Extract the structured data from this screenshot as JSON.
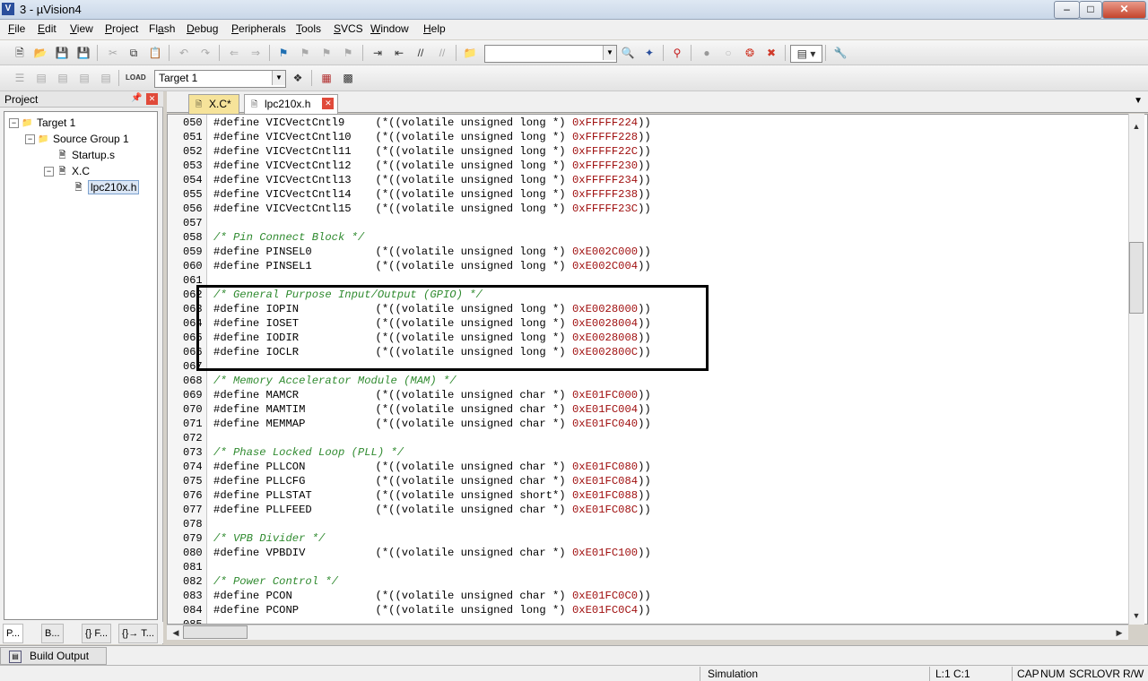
{
  "window": {
    "title": "3 - µVision4",
    "app_icon": "V"
  },
  "menu": [
    "File",
    "Edit",
    "View",
    "Project",
    "Flash",
    "Debug",
    "Peripherals",
    "Tools",
    "SVCS",
    "Window",
    "Help"
  ],
  "menu_underline": [
    "F",
    "E",
    "V",
    "P",
    "a",
    "D",
    "P",
    "T",
    "S",
    "W",
    "H"
  ],
  "toolbar2": {
    "target_label": "Target 1"
  },
  "project": {
    "header": "Project",
    "tree": [
      {
        "label": "Target 1",
        "level": 0,
        "expand": "−",
        "icon": "folder-icon"
      },
      {
        "label": "Source Group 1",
        "level": 1,
        "expand": "−",
        "icon": "folder-icon"
      },
      {
        "label": "Startup.s",
        "level": 2,
        "expand": "",
        "icon": "file-icon"
      },
      {
        "label": "X.C",
        "level": 2,
        "expand": "−",
        "icon": "file-icon"
      },
      {
        "label": "lpc210x.h",
        "level": 3,
        "expand": "",
        "icon": "header-file-icon"
      }
    ],
    "bottom_tabs": [
      "P...",
      "B...",
      "{} F...",
      "{}→ T..."
    ]
  },
  "editor": {
    "tabs": [
      {
        "label": "X.C*",
        "active": false
      },
      {
        "label": "lpc210x.h",
        "active": true
      }
    ],
    "lines": [
      {
        "n": "050",
        "kind": "def",
        "name": "VICVectCntl9",
        "cast": "(*((volatile unsigned long *) ",
        "addr": "0xFFFFF224",
        "tail": "))"
      },
      {
        "n": "051",
        "kind": "def",
        "name": "VICVectCntl10",
        "cast": "(*((volatile unsigned long *) ",
        "addr": "0xFFFFF228",
        "tail": "))"
      },
      {
        "n": "052",
        "kind": "def",
        "name": "VICVectCntl11",
        "cast": "(*((volatile unsigned long *) ",
        "addr": "0xFFFFF22C",
        "tail": "))"
      },
      {
        "n": "053",
        "kind": "def",
        "name": "VICVectCntl12",
        "cast": "(*((volatile unsigned long *) ",
        "addr": "0xFFFFF230",
        "tail": "))"
      },
      {
        "n": "054",
        "kind": "def",
        "name": "VICVectCntl13",
        "cast": "(*((volatile unsigned long *) ",
        "addr": "0xFFFFF234",
        "tail": "))"
      },
      {
        "n": "055",
        "kind": "def",
        "name": "VICVectCntl14",
        "cast": "(*((volatile unsigned long *) ",
        "addr": "0xFFFFF238",
        "tail": "))"
      },
      {
        "n": "056",
        "kind": "def",
        "name": "VICVectCntl15",
        "cast": "(*((volatile unsigned long *) ",
        "addr": "0xFFFFF23C",
        "tail": "))"
      },
      {
        "n": "057",
        "kind": "blank"
      },
      {
        "n": "058",
        "kind": "comment",
        "text": "/* Pin Connect Block */"
      },
      {
        "n": "059",
        "kind": "def",
        "name": "PINSEL0",
        "cast": "(*((volatile unsigned long *) ",
        "addr": "0xE002C000",
        "tail": "))"
      },
      {
        "n": "060",
        "kind": "def",
        "name": "PINSEL1",
        "cast": "(*((volatile unsigned long *) ",
        "addr": "0xE002C004",
        "tail": "))"
      },
      {
        "n": "061",
        "kind": "blank"
      },
      {
        "n": "062",
        "kind": "comment",
        "text": "/* General Purpose Input/Output (GPIO) */"
      },
      {
        "n": "063",
        "kind": "def",
        "name": "IOPIN",
        "cast": "(*((volatile unsigned long *) ",
        "addr": "0xE0028000",
        "tail": "))"
      },
      {
        "n": "064",
        "kind": "def",
        "name": "IOSET",
        "cast": "(*((volatile unsigned long *) ",
        "addr": "0xE0028004",
        "tail": "))"
      },
      {
        "n": "065",
        "kind": "def",
        "name": "IODIR",
        "cast": "(*((volatile unsigned long *) ",
        "addr": "0xE0028008",
        "tail": "))"
      },
      {
        "n": "066",
        "kind": "def",
        "name": "IOCLR",
        "cast": "(*((volatile unsigned long *) ",
        "addr": "0xE002800C",
        "tail": "))"
      },
      {
        "n": "067",
        "kind": "blank"
      },
      {
        "n": "068",
        "kind": "comment",
        "text": "/* Memory Accelerator Module (MAM) */"
      },
      {
        "n": "069",
        "kind": "def",
        "name": "MAMCR",
        "cast": "(*((volatile unsigned char *) ",
        "addr": "0xE01FC000",
        "tail": "))"
      },
      {
        "n": "070",
        "kind": "def",
        "name": "MAMTIM",
        "cast": "(*((volatile unsigned char *) ",
        "addr": "0xE01FC004",
        "tail": "))"
      },
      {
        "n": "071",
        "kind": "def",
        "name": "MEMMAP",
        "cast": "(*((volatile unsigned char *) ",
        "addr": "0xE01FC040",
        "tail": "))"
      },
      {
        "n": "072",
        "kind": "blank"
      },
      {
        "n": "073",
        "kind": "comment",
        "text": "/* Phase Locked Loop (PLL) */"
      },
      {
        "n": "074",
        "kind": "def",
        "name": "PLLCON",
        "cast": "(*((volatile unsigned char *) ",
        "addr": "0xE01FC080",
        "tail": "))"
      },
      {
        "n": "075",
        "kind": "def",
        "name": "PLLCFG",
        "cast": "(*((volatile unsigned char *) ",
        "addr": "0xE01FC084",
        "tail": "))"
      },
      {
        "n": "076",
        "kind": "def",
        "name": "PLLSTAT",
        "cast": "(*((volatile unsigned short*) ",
        "addr": "0xE01FC088",
        "tail": "))"
      },
      {
        "n": "077",
        "kind": "def",
        "name": "PLLFEED",
        "cast": "(*((volatile unsigned char *) ",
        "addr": "0xE01FC08C",
        "tail": "))"
      },
      {
        "n": "078",
        "kind": "blank"
      },
      {
        "n": "079",
        "kind": "comment",
        "text": "/* VPB Divider */"
      },
      {
        "n": "080",
        "kind": "def",
        "name": "VPBDIV",
        "cast": "(*((volatile unsigned char *) ",
        "addr": "0xE01FC100",
        "tail": "))"
      },
      {
        "n": "081",
        "kind": "blank"
      },
      {
        "n": "082",
        "kind": "comment",
        "text": "/* Power Control */"
      },
      {
        "n": "083",
        "kind": "def",
        "name": "PCON",
        "cast": "(*((volatile unsigned char *) ",
        "addr": "0xE01FC0C0",
        "tail": "))"
      },
      {
        "n": "084",
        "kind": "def",
        "name": "PCONP",
        "cast": "(*((volatile unsigned long *) ",
        "addr": "0xE01FC0C4",
        "tail": "))"
      },
      {
        "n": "085",
        "kind": "blank"
      }
    ]
  },
  "build_output": {
    "label": "Build Output"
  },
  "status": {
    "mode": "Simulation",
    "pos": "L:1 C:1",
    "cap": "CAP",
    "num": "NUM",
    "scrl": "SCRL",
    "ovr": "OVR",
    "rw": "R/W"
  },
  "colors": {
    "comment": "#2f8a2f",
    "hex": "#a01010",
    "highlight_box": "#000000"
  }
}
